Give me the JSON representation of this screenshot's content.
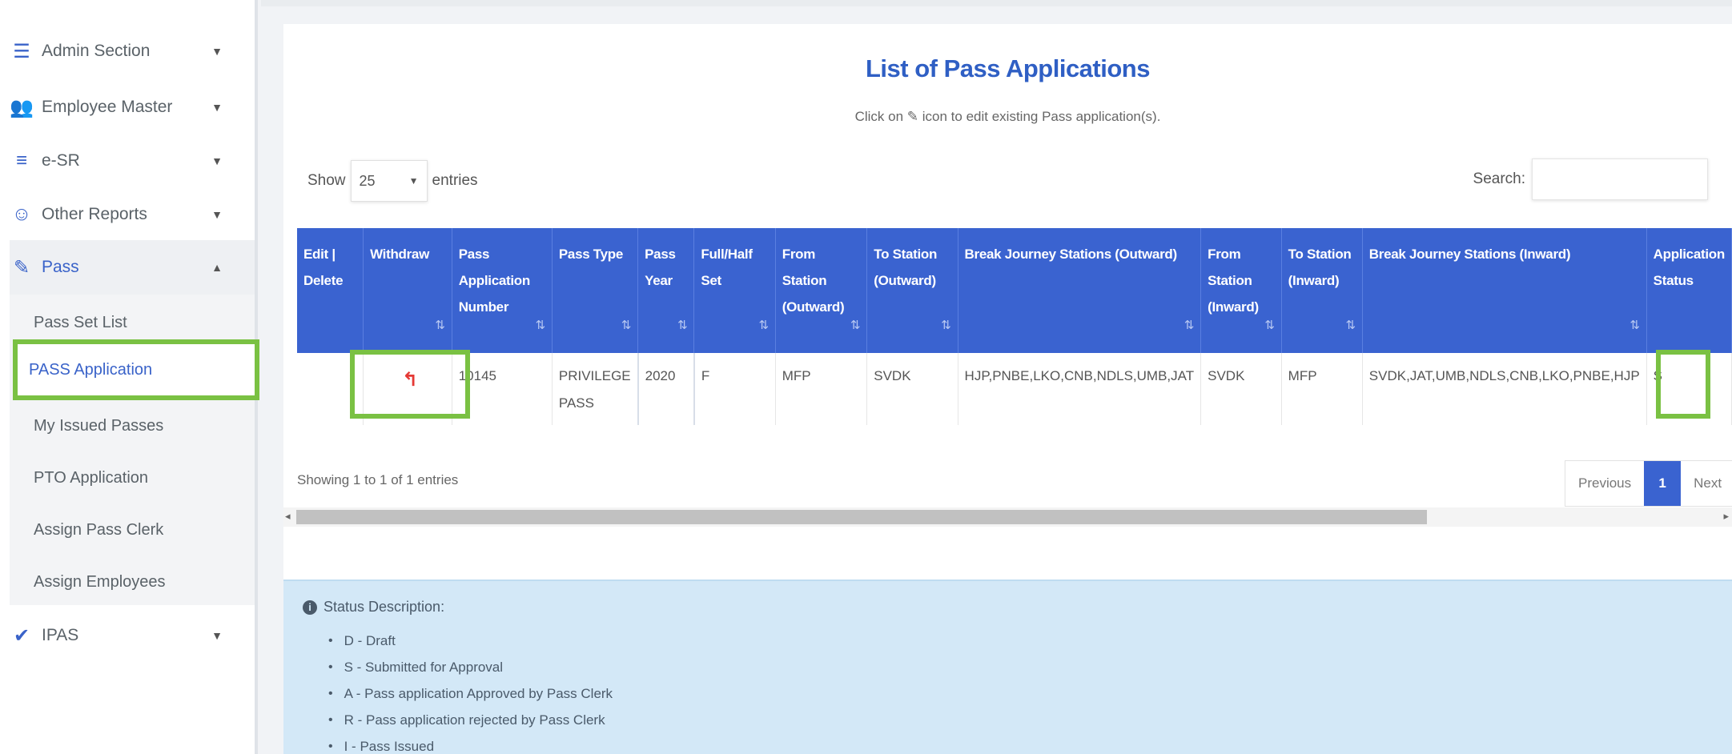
{
  "sidebar": {
    "items": [
      {
        "label": "Admin Section",
        "icon": "menu-icon",
        "glyph": "☰",
        "caret": "▼"
      },
      {
        "label": "Employee Master",
        "icon": "users-icon",
        "glyph": "👥",
        "caret": "▼"
      },
      {
        "label": "e-SR",
        "icon": "list-icon",
        "glyph": "≡",
        "caret": "▼"
      },
      {
        "label": "Other Reports",
        "icon": "user-circle-icon",
        "glyph": "☺",
        "caret": "▼"
      },
      {
        "label": "Pass",
        "icon": "ticket-icon",
        "glyph": "✎",
        "caret": "▲"
      },
      {
        "label": "IPAS",
        "icon": "check-circle-icon",
        "glyph": "✔",
        "caret": "▼"
      }
    ],
    "pass_submenu": [
      "Pass Set List",
      "PASS Application",
      "My Issued Passes",
      "PTO Application",
      "Assign Pass Clerk",
      "Assign Employees"
    ]
  },
  "page": {
    "title": "List of Pass Applications",
    "subtitle_pre": "Click on",
    "subtitle_icon": "✎",
    "subtitle_post": "icon to edit existing Pass application(s)."
  },
  "controls": {
    "show_label": "Show",
    "entries_value": "25",
    "entries_label": "entries",
    "search_label": "Search:"
  },
  "table": {
    "headers": [
      "Edit | Delete",
      "Withdraw",
      "Pass Application Number",
      "Pass Type",
      "Pass Year",
      "Full/Half Set",
      "From Station (Outward)",
      "To Station (Outward)",
      "Break Journey Stations (Outward)",
      "From Station (Inward)",
      "To Station (Inward)",
      "Break Journey Stations (Inward)",
      "Application Status"
    ],
    "sort_glyph": "⇅",
    "row": {
      "edit": "",
      "withdraw_icon": "↰",
      "app_no": "10145",
      "pass_type": "PRIVILEGE PASS",
      "pass_year": "2020",
      "full_half": "F",
      "from_out": "MFP",
      "to_out": "SVDK",
      "break_out": "HJP,PNBE,LKO,CNB,NDLS,UMB,JAT",
      "from_in": "SVDK",
      "to_in": "MFP",
      "break_in": "SVDK,JAT,UMB,NDLS,CNB,LKO,PNBE,HJP",
      "status": "S"
    }
  },
  "footer": {
    "info": "Showing 1 to 1 of 1 entries",
    "prev": "Previous",
    "page": "1",
    "next": "Next",
    "scroll_left": "◂",
    "scroll_right": "▸"
  },
  "status_desc": {
    "title": "Status Description:",
    "info_glyph": "i",
    "items": [
      "D - Draft",
      "S - Submitted for Approval",
      "A - Pass application Approved by Pass Clerk",
      "R - Pass application rejected by Pass Clerk",
      "I - Pass Issued"
    ]
  },
  "colors": {
    "accent": "#3a63d0",
    "highlight": "#7ac143",
    "info_bg": "#d3e8f7"
  }
}
